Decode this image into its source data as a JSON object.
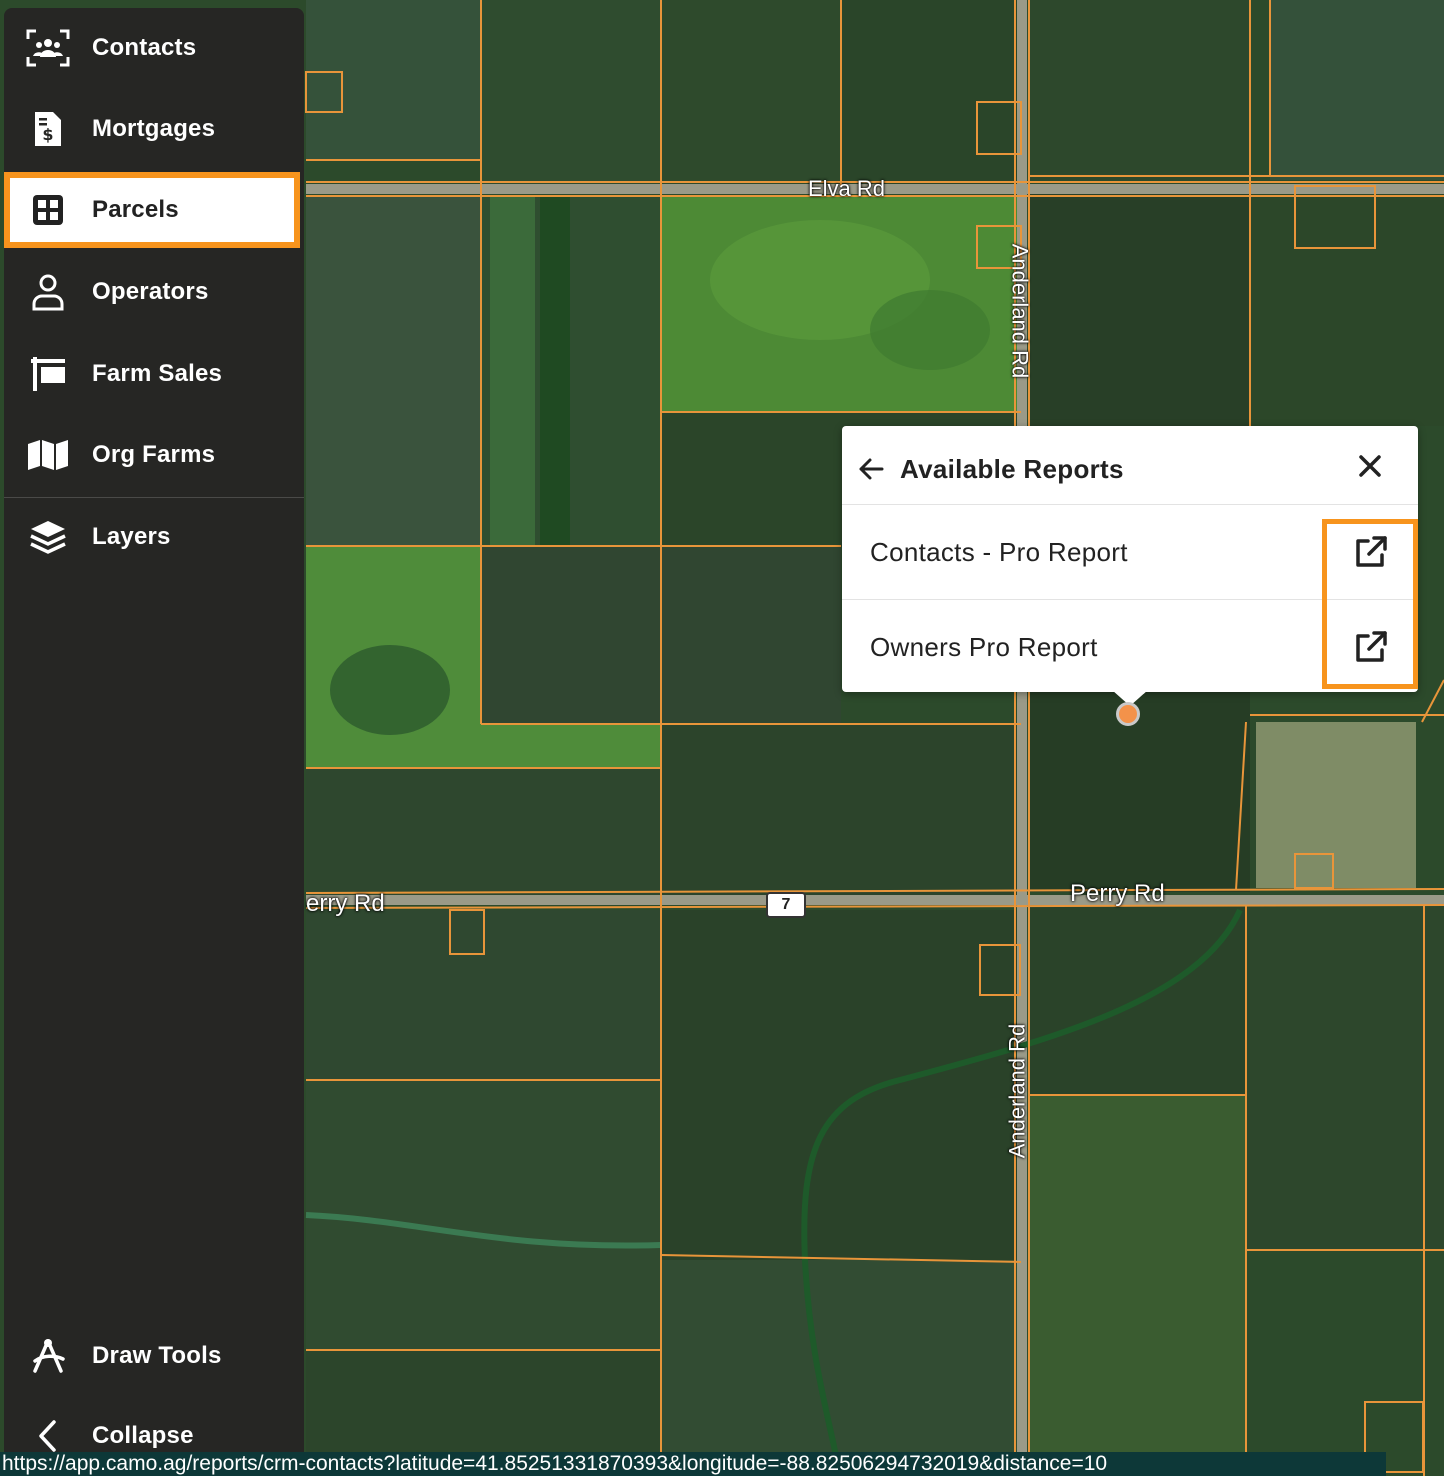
{
  "sidebar": {
    "items": [
      {
        "label": "Contacts",
        "icon": "contacts-icon"
      },
      {
        "label": "Mortgages",
        "icon": "mortgage-document-icon"
      },
      {
        "label": "Parcels",
        "icon": "parcels-grid-icon",
        "active": true
      },
      {
        "label": "Operators",
        "icon": "operator-person-icon"
      },
      {
        "label": "Farm Sales",
        "icon": "farm-sales-sign-icon"
      },
      {
        "label": "Org Farms",
        "icon": "map-icon"
      },
      {
        "label": "Layers",
        "icon": "layers-icon"
      }
    ],
    "bottom": [
      {
        "label": "Draw Tools",
        "icon": "draw-tools-icon"
      },
      {
        "label": "Collapse",
        "icon": "chevron-left-icon"
      }
    ]
  },
  "popup": {
    "title": "Available Reports",
    "reports": [
      {
        "label": "Contacts - Pro Report"
      },
      {
        "label": "Owners Pro Report"
      }
    ]
  },
  "map": {
    "roads": {
      "elva": "Elva Rd",
      "perry_left": "erry Rd",
      "perry_right": "Perry Rd",
      "anderland_top": "Anderland Rd",
      "anderland_bottom": "Anderland Rd",
      "route_shield": "7"
    }
  },
  "statusbar": {
    "url": "https://app.camo.ag/reports/crm-contacts?latitude=41.85251331870393&longitude=-88.82506294732019&distance=10"
  },
  "colors": {
    "accent": "#f7941d",
    "sidebar_bg": "#262624",
    "parcel_line": "#e8953a"
  }
}
